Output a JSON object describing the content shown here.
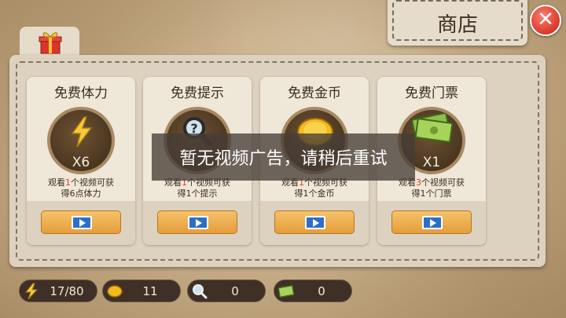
{
  "shop": {
    "title": "商店"
  },
  "close": {
    "symbol": "✕"
  },
  "cards": [
    {
      "title": "免费体力",
      "count": "X6",
      "desc_prefix": "观看",
      "desc_num": "1",
      "desc_suffix": "个视频可获",
      "desc_line2": "得6点体力",
      "icon": "lightning-icon"
    },
    {
      "title": "免费提示",
      "count": "",
      "desc_prefix": "观看",
      "desc_num": "1",
      "desc_suffix": "个视频可获",
      "desc_line2": "得1个提示",
      "icon": "magnifier-icon"
    },
    {
      "title": "免费金币",
      "count": "",
      "desc_prefix": "观看",
      "desc_num": "1",
      "desc_suffix": "个视频可获",
      "desc_line2": "得1个金币",
      "icon": "gold-coin-icon"
    },
    {
      "title": "免费门票",
      "count": "X1",
      "desc_prefix": "观看",
      "desc_num": "3",
      "desc_suffix": "个视频可获",
      "desc_line2": "得1个门票",
      "icon": "banknote-icon"
    }
  ],
  "toast": {
    "text": "暂无视频广告，请稍后重试"
  },
  "resources": [
    {
      "icon": "lightning-icon",
      "value": "17/80"
    },
    {
      "icon": "gold-coin-icon",
      "value": "11"
    },
    {
      "icon": "magnifier-icon",
      "value": "0"
    },
    {
      "icon": "banknote-icon",
      "value": "0"
    }
  ],
  "colors": {
    "accent": "#e59d3a",
    "highlight": "#e03a1e",
    "close": "#d63a2a"
  }
}
